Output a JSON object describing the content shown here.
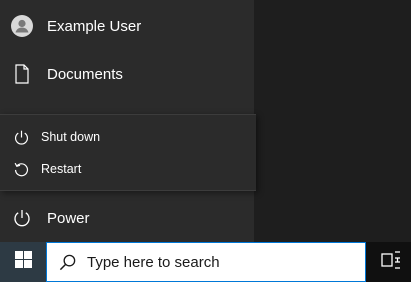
{
  "start_menu": {
    "user": {
      "name": "Example User",
      "icon": "user-avatar-icon"
    },
    "documents": {
      "label": "Documents",
      "icon": "document-icon"
    },
    "power": {
      "label": "Power",
      "icon": "power-icon"
    }
  },
  "power_flyout": {
    "items": [
      {
        "label": "Shut down",
        "icon": "power-icon"
      },
      {
        "label": "Restart",
        "icon": "restart-icon"
      }
    ]
  },
  "taskbar": {
    "start_icon": "windows-logo-icon",
    "search": {
      "placeholder": "Type here to search",
      "icon": "search-icon"
    },
    "task_view_icon": "task-view-icon"
  },
  "colors": {
    "menu_bg": "#2b2b2b",
    "taskbar_bg": "#101010",
    "accent": "#0078d7"
  }
}
